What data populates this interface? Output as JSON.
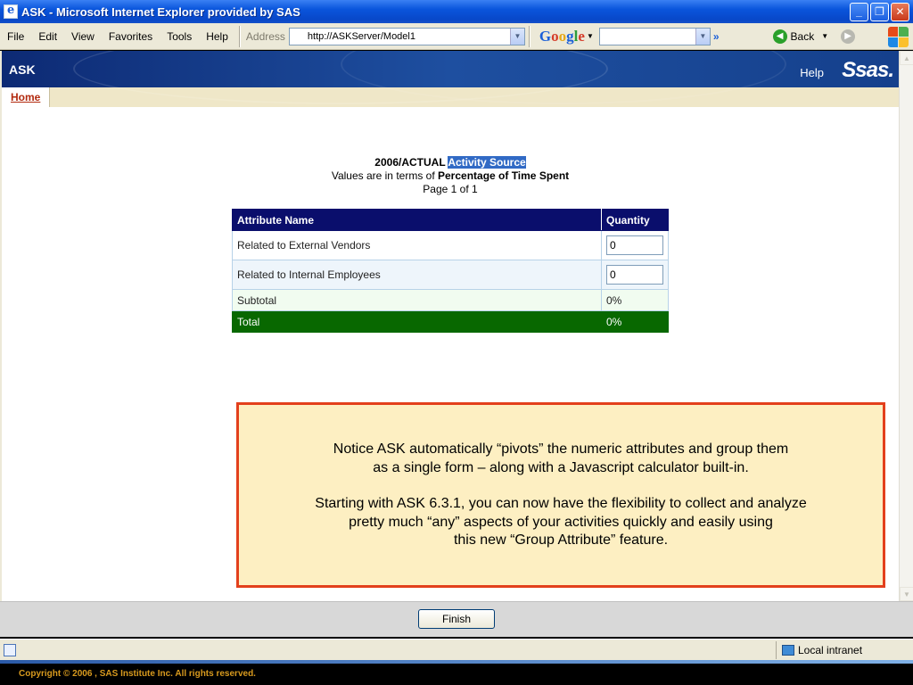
{
  "window": {
    "title": "ASK - Microsoft Internet Explorer provided by SAS",
    "minimize": "_",
    "maximize": "❐",
    "close": "✕"
  },
  "menu": {
    "items": [
      "File",
      "Edit",
      "View",
      "Favorites",
      "Tools",
      "Help"
    ],
    "address_label": "Address",
    "address_url": "http://ASKServer/Model1",
    "google_label": "Google",
    "more_chevron": "»",
    "back_label": "Back"
  },
  "app": {
    "brand": "ASK",
    "help": "Help",
    "logo": "Ssas."
  },
  "tabs": {
    "home": "Home"
  },
  "page": {
    "heading_prefix": "2006/ACTUAL",
    "heading_highlight": "Activity Source",
    "values_prefix": "Values are in terms of",
    "values_measure": "Percentage of Time Spent",
    "page_info": "Page 1 of 1"
  },
  "table": {
    "headers": [
      "Attribute Name",
      "Quantity"
    ],
    "rows": [
      {
        "name": "Related to External Vendors",
        "value": "0"
      },
      {
        "name": "Related to Internal Employees",
        "value": "0"
      }
    ],
    "subtotal_label": "Subtotal",
    "subtotal_value": "0%",
    "total_label": "Total",
    "total_value": "0%"
  },
  "callout": {
    "p1_line1": "Notice ASK automatically “pivots” the numeric attributes and group them",
    "p1_line2": "as a single form – along with a Javascript calculator built-in.",
    "p2_line1": "Starting with ASK 6.3.1, you can now have the flexibility to collect and analyze",
    "p2_line2": "pretty much “any” aspects  of your activities quickly and easily using",
    "p2_line3": "this new “Group Attribute” feature."
  },
  "buttons": {
    "finish": "Finish"
  },
  "status": {
    "zone": "Local intranet"
  },
  "footer": {
    "copyright": "Copyright © 2006 , SAS Institute Inc. All rights reserved."
  },
  "colors": {
    "header_navy": "#0a0e6c",
    "total_green": "#086800",
    "callout_border": "#e3401c",
    "callout_fill": "#fdefc2",
    "footer_text": "#d89a1e"
  }
}
